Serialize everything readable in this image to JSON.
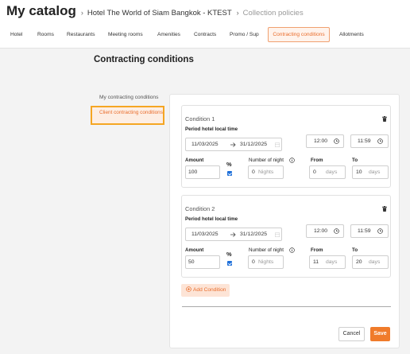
{
  "breadcrumb": {
    "title": "My catalog",
    "hotel": "Hotel The World of Siam Bangkok - KTEST",
    "policies": "Collection policies"
  },
  "tabs": [
    {
      "label": "Hotel",
      "active": false
    },
    {
      "label": "Rooms",
      "active": false
    },
    {
      "label": "Restaurants",
      "active": false
    },
    {
      "label": "Meeting rooms",
      "active": false
    },
    {
      "label": "Amenities",
      "active": false
    },
    {
      "label": "Contracts",
      "active": false
    },
    {
      "label": "Promo / Sup",
      "active": false
    },
    {
      "label": "Contracting conditions",
      "active": true
    },
    {
      "label": "Allotments",
      "active": false
    }
  ],
  "page_title": "Contracting conditions",
  "side_menu": {
    "my_conditions": "My contracting conditions",
    "client_conditions": "Client contracting conditions"
  },
  "labels": {
    "period": "Period hotel local time",
    "amount": "Amount",
    "percent": "%",
    "nights": "Number of night",
    "from": "From",
    "to": "To",
    "nights_unit": "Nights",
    "days_unit": "days"
  },
  "conditions": [
    {
      "title": "Condition 1",
      "start_date": "11/03/2025",
      "end_date": "31/12/2025",
      "start_time": "12:00",
      "end_time": "11:59",
      "amount": "100",
      "percent_checked": true,
      "nights": "0",
      "from_days": "0",
      "to_days": "10"
    },
    {
      "title": "Condition 2",
      "start_date": "11/03/2025",
      "end_date": "31/12/2025",
      "start_time": "12:00",
      "end_time": "11:59",
      "amount": "50",
      "percent_checked": true,
      "nights": "0",
      "from_days": "11",
      "to_days": "20"
    }
  ],
  "actions": {
    "add_condition": "Add Condition",
    "cancel": "Cancel",
    "save": "Save"
  },
  "colors": {
    "accent": "#f07b2b",
    "highlight_border": "#f5a623",
    "checkbox": "#1e6fd9"
  },
  "icons": [
    "trash-icon",
    "calendar-icon",
    "clock-icon",
    "info-icon",
    "plus-circle-icon",
    "arrow-right-icon"
  ]
}
